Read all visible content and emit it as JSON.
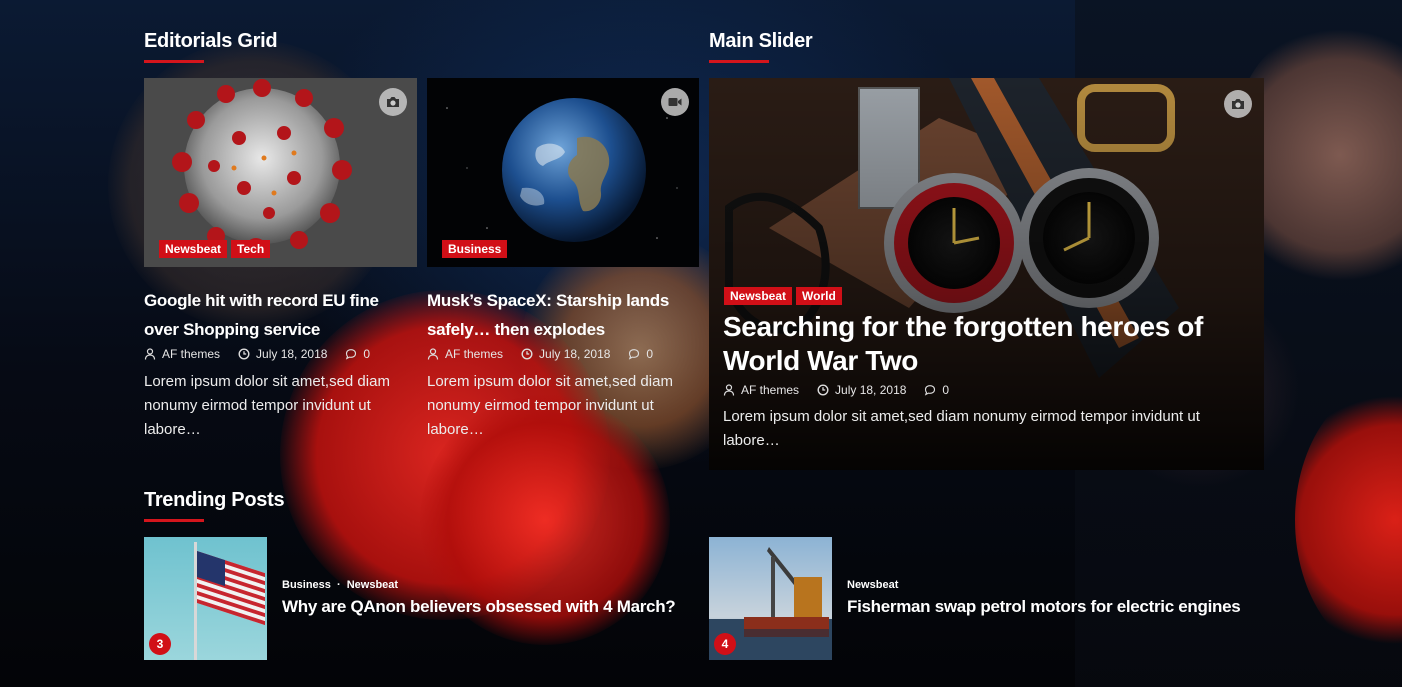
{
  "editorials": {
    "section_title": "Editorials Grid",
    "items": [
      {
        "media": "camera-icon",
        "categories": [
          "Newsbeat",
          "Tech"
        ],
        "title_line1": "Google hit with record EU fine",
        "title_line2": "over Shopping service",
        "author": "AF themes",
        "date": "July 18, 2018",
        "comments": "0",
        "excerpt_line1": "Lorem ipsum dolor sit amet,sed diam",
        "excerpt_line2": "nonumy eirmod tempor invidunt ut",
        "excerpt_line3": "labore…"
      },
      {
        "media": "video-icon",
        "categories": [
          "Business"
        ],
        "title_line1": "Musk’s SpaceX: Starship lands",
        "title_line2": "safely… then explodes",
        "author": "AF themes",
        "date": "July 18, 2018",
        "comments": "0",
        "excerpt_line1": "Lorem ipsum dolor sit amet,sed diam",
        "excerpt_line2": "nonumy eirmod tempor invidunt ut",
        "excerpt_line3": "labore…"
      }
    ]
  },
  "slider": {
    "section_title": "Main Slider",
    "media": "camera-icon",
    "categories": [
      "Newsbeat",
      "World"
    ],
    "title_line1": "Searching for the forgotten heroes of",
    "title_line2": "World War Two",
    "author": "AF themes",
    "date": "July 18, 2018",
    "comments": "0",
    "excerpt_line1": "Lorem ipsum dolor sit amet,sed diam nonumy eirmod tempor invidunt ut",
    "excerpt_line2": "labore…"
  },
  "trending": {
    "section_title": "Trending Posts",
    "items": [
      {
        "rank": "3",
        "categories": "Business",
        "categories2": "Newsbeat",
        "title": "Why are QAnon believers obsessed with 4 March?"
      },
      {
        "rank": "4",
        "categories": "Newsbeat",
        "title": "Fisherman swap petrol motors for electric engines"
      }
    ]
  },
  "colors": {
    "accent": "#d10f17",
    "background": "#05070d"
  }
}
